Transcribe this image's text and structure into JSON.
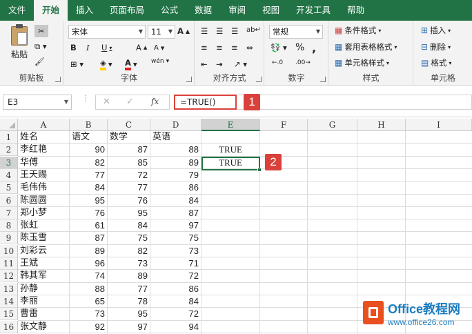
{
  "tabs": [
    "文件",
    "开始",
    "插入",
    "页面布局",
    "公式",
    "数据",
    "审阅",
    "视图",
    "开发工具",
    "帮助"
  ],
  "active_tab_index": 1,
  "ribbon": {
    "clipboard": {
      "paste": "粘贴",
      "label": "剪贴板"
    },
    "font": {
      "name": "宋体",
      "size": "11",
      "label": "字体",
      "bold": "B",
      "italic": "I",
      "underline": "U",
      "grow": "A",
      "shrink": "A",
      "phonetic": "wén"
    },
    "alignment": {
      "label": "对齐方式"
    },
    "number": {
      "format": "常规",
      "percent": "%",
      "comma": ",",
      "label": "数字"
    },
    "styles": {
      "conditional": "条件格式",
      "table": "套用表格格式",
      "cell": "单元格样式",
      "label": "样式"
    },
    "cells": {
      "insert": "插入",
      "delete": "删除",
      "format": "格式",
      "label": "单元格"
    }
  },
  "formula_bar": {
    "name_box": "E3",
    "formula": "=TRUE()",
    "fx": "fx",
    "cancel": "✕",
    "enter": "✓"
  },
  "callouts": [
    "1",
    "2"
  ],
  "sheet": {
    "columns": [
      "A",
      "B",
      "C",
      "D",
      "E",
      "F",
      "G",
      "H",
      "I"
    ],
    "rows": [
      "1",
      "2",
      "3",
      "4",
      "5",
      "6",
      "7",
      "8",
      "9",
      "10",
      "11",
      "12",
      "13",
      "14",
      "15",
      "16"
    ],
    "header": [
      "姓名",
      "语文",
      "数学",
      "英语"
    ],
    "records": [
      [
        "李红艳",
        "90",
        "87",
        "88",
        "TRUE"
      ],
      [
        "华傅",
        "82",
        "85",
        "89",
        "TRUE"
      ],
      [
        "王天赐",
        "77",
        "72",
        "79",
        ""
      ],
      [
        "毛伟伟",
        "84",
        "77",
        "86",
        ""
      ],
      [
        "陈圆圆",
        "95",
        "76",
        "84",
        ""
      ],
      [
        "郑小梦",
        "76",
        "95",
        "87",
        ""
      ],
      [
        "张虹",
        "61",
        "84",
        "97",
        ""
      ],
      [
        "陈玉雪",
        "87",
        "75",
        "75",
        ""
      ],
      [
        "刘彩云",
        "89",
        "82",
        "73",
        ""
      ],
      [
        "王斌",
        "96",
        "73",
        "71",
        ""
      ],
      [
        "韩其军",
        "74",
        "89",
        "72",
        ""
      ],
      [
        "孙静",
        "88",
        "77",
        "86",
        ""
      ],
      [
        "李丽",
        "65",
        "78",
        "84",
        ""
      ],
      [
        "曹雷",
        "73",
        "95",
        "72",
        ""
      ],
      [
        "张文静",
        "92",
        "97",
        "94",
        ""
      ]
    ]
  },
  "watermark": {
    "line1": "Office教程网",
    "line2": "www.office26.com"
  }
}
